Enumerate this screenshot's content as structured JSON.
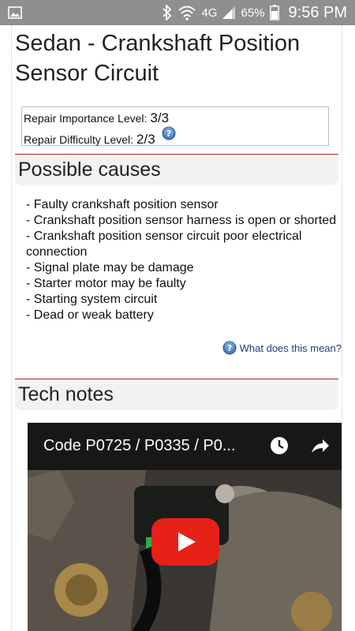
{
  "status_bar": {
    "network_type": "4G",
    "battery_percent": "65%",
    "time": "9:56 PM",
    "icons": [
      "image-icon",
      "bluetooth-icon",
      "wifi-icon",
      "signal-icon",
      "battery-icon"
    ]
  },
  "page": {
    "title": "Sedan - Crankshaft Position Sensor Circuit",
    "repair": {
      "importance_label": "Repair Importance Level:",
      "importance_value": "3/3",
      "difficulty_label": "Repair Difficulty Level:",
      "difficulty_value": "2/3"
    },
    "causes_header": "Possible causes",
    "causes": [
      "- Faulty crankshaft position sensor",
      "- Crankshaft position sensor harness is open or shorted",
      "- Crankshaft position sensor circuit poor electrical connection",
      "- Signal plate may be damage",
      "- Starter motor may be faulty",
      "- Starting system circuit",
      "- Dead or weak battery"
    ],
    "what_link": "What does this mean?",
    "tech_notes_header": "Tech notes",
    "video": {
      "title": "Code P0725 / P0335 / P0...",
      "play_color": "#e62117"
    }
  },
  "colors": {
    "status_bar": "#8f8f8f",
    "section_rule": "#b22222",
    "link": "#1a3e7a"
  }
}
